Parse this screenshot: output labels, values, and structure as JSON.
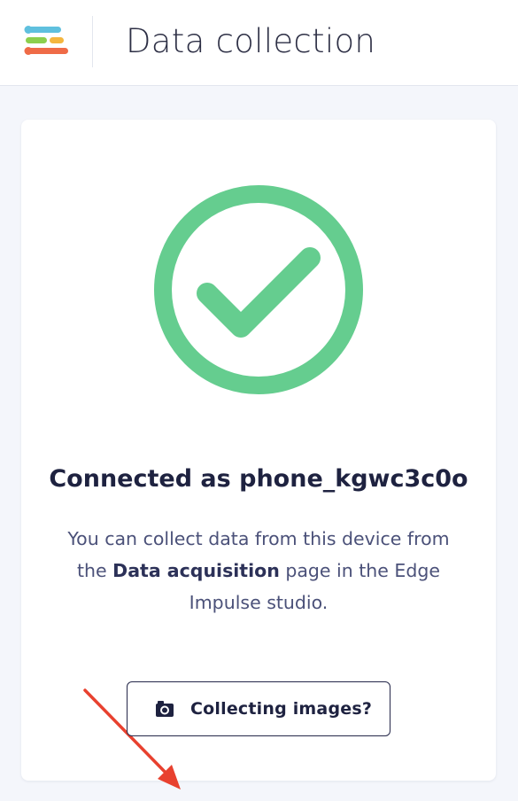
{
  "header": {
    "title": "Data collection",
    "logo_icon": "edge-impulse-logo-icon"
  },
  "status": {
    "icon": "check-circle-icon",
    "icon_color": "#65cd8f",
    "title": "Connected as phone_kgwc3c0o",
    "desc_prefix": "You can collect data from this device from the ",
    "desc_bold": "Data acquisition",
    "desc_suffix": " page in the Edge Impulse studio."
  },
  "annotation": {
    "arrow_color": "#e8412f"
  },
  "actions": {
    "collect_images_label": "Collecting images?",
    "collect_images_icon": "camera-icon"
  }
}
